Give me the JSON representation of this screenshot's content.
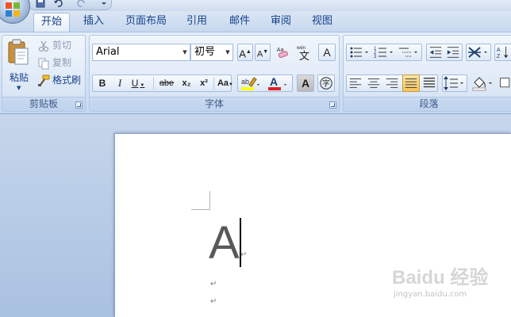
{
  "tabs": [
    "开始",
    "插入",
    "页面布局",
    "引用",
    "邮件",
    "审阅",
    "视图"
  ],
  "active_tab": "开始",
  "clipboard": {
    "group_label": "剪贴板",
    "paste_label": "粘贴",
    "cut_label": "剪切",
    "copy_label": "复制",
    "format_painter_label": "格式刷"
  },
  "font": {
    "group_label": "字体",
    "font_name": "Arial",
    "font_size": "初号",
    "bold": "B",
    "italic": "I",
    "underline": "U",
    "strikethrough": "abe",
    "subscript": "x₂",
    "superscript": "x²",
    "change_case": "Aa",
    "grow_font": "A",
    "shrink_font": "A",
    "phonetic_guide": "变",
    "char_border": "A",
    "char_shading": "A",
    "enclose_char": "字",
    "font_color": "A",
    "font_color_value": "#e02020",
    "highlight_value": "#ffff00"
  },
  "paragraph": {
    "group_label": "段落"
  },
  "document": {
    "letter": "A"
  },
  "watermark": {
    "text": "Baidu 经验",
    "url": "jingyan.baidu.com"
  }
}
